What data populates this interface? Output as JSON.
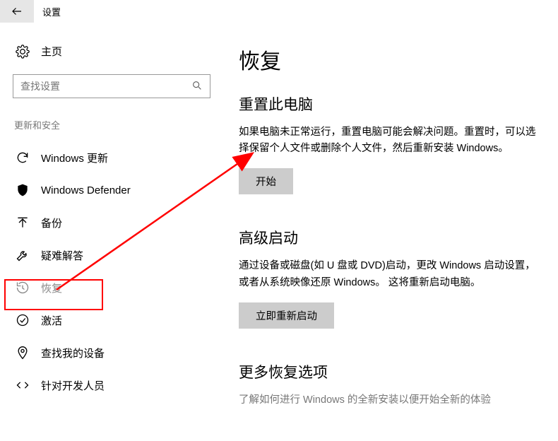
{
  "header": {
    "title": "设置"
  },
  "sidebar": {
    "home": "主页",
    "searchPlaceholder": "查找设置",
    "sectionLabel": "更新和安全",
    "items": [
      {
        "label": "Windows 更新"
      },
      {
        "label": "Windows Defender"
      },
      {
        "label": "备份"
      },
      {
        "label": "疑难解答"
      },
      {
        "label": "恢复"
      },
      {
        "label": "激活"
      },
      {
        "label": "查找我的设备"
      },
      {
        "label": "针对开发人员"
      }
    ]
  },
  "main": {
    "title": "恢复",
    "sections": {
      "reset": {
        "title": "重置此电脑",
        "desc": "如果电脑未正常运行，重置电脑可能会解决问题。重置时，可以选择保留个人文件或删除个人文件，然后重新安装 Windows。",
        "button": "开始"
      },
      "advanced": {
        "title": "高级启动",
        "desc": "通过设备或磁盘(如 U 盘或 DVD)启动，更改 Windows 启动设置，或者从系统映像还原 Windows。 这将重新启动电脑。",
        "button": "立即重新启动"
      },
      "more": {
        "title": "更多恢复选项",
        "desc": "了解如何进行 Windows 的全新安装以便开始全新的体验"
      }
    }
  }
}
